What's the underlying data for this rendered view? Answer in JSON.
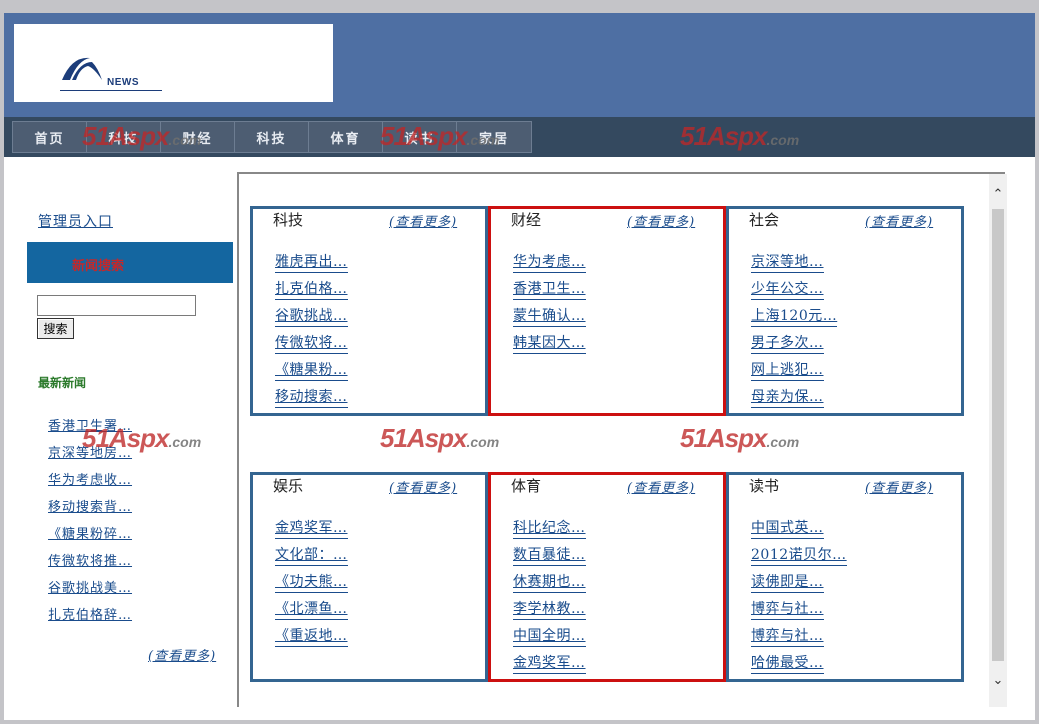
{
  "logo": {
    "text": "NEWS"
  },
  "nav": [
    "首页",
    "科技",
    "财经",
    "科技",
    "体育",
    "读书",
    "家居"
  ],
  "watermark": {
    "main": "51Aspx",
    "suffix": ".com"
  },
  "sidebar": {
    "admin_link": "管理员入口",
    "search_bar_label": "新闻搜索",
    "search_placeholder": "",
    "search_button": "搜索",
    "latest_title": "最新新闻",
    "latest_items": [
      "香港卫生署…",
      "京深等地房…",
      "华为考虑收…",
      "移动搜索背…",
      "《糖果粉碎…",
      "传微软将推…",
      "谷歌挑战美…",
      "扎克伯格辞…"
    ],
    "more": "(查看更多)"
  },
  "categories": [
    {
      "name": "科技",
      "more": "(查看更多)",
      "items": [
        "雅虎再出…",
        "扎克伯格…",
        "谷歌挑战…",
        "传微软将…",
        "《糖果粉…",
        "移动搜索…"
      ],
      "highlight": false
    },
    {
      "name": "财经",
      "more": "(查看更多)",
      "items": [
        "华为考虑…",
        "香港卫生…",
        "蒙牛确认…",
        "韩某因大…"
      ],
      "highlight": true
    },
    {
      "name": "社会",
      "more": "(查看更多)",
      "items": [
        "京深等地…",
        "少年公交…",
        "上海120元…",
        "男子多次…",
        "网上逃犯…",
        "母亲为保…"
      ],
      "highlight": false
    },
    {
      "name": "娱乐",
      "more": "(查看更多)",
      "items": [
        "金鸡奖军…",
        "文化部：…",
        "《功夫熊…",
        "《北漂鱼…",
        "《重返地…"
      ],
      "highlight": false
    },
    {
      "name": "体育",
      "more": "(查看更多)",
      "items": [
        "科比纪念…",
        "数百暴徒…",
        "休赛期也…",
        "李学林教…",
        "中国全明…",
        "金鸡奖军…"
      ],
      "highlight": true
    },
    {
      "name": "读书",
      "more": "(查看更多)",
      "items": [
        "中国式英…",
        "2012诺贝尔…",
        "读佛即是…",
        "博弈与社…",
        "博弈与社…",
        "哈佛最受…"
      ],
      "highlight": false
    }
  ],
  "colors": {
    "header": "#4e6fa3",
    "nav": "#34495f",
    "accent_box": "#346591",
    "highlight_box": "#cc1010",
    "search_bar": "#1466a0"
  }
}
